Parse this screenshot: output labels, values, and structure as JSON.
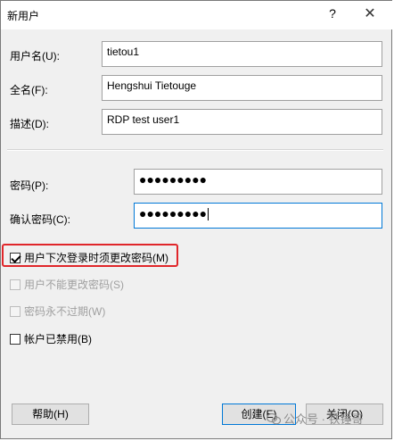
{
  "window": {
    "title": "新用户",
    "help_glyph": "?",
    "close_glyph": "✕"
  },
  "form": {
    "username_label": "用户名(U):",
    "username_value": "tietou1",
    "fullname_label": "全名(F):",
    "fullname_value": "Hengshui Tietouge",
    "description_label": "描述(D):",
    "description_value": "RDP test user1",
    "password_label": "密码(P):",
    "password_value": "●●●●●●●●●",
    "confirm_label": "确认密码(C):",
    "confirm_value": "●●●●●●●●●"
  },
  "options": {
    "must_change": {
      "label": "用户下次登录时须更改密码(M)",
      "checked": true
    },
    "cannot_change": {
      "label": "用户不能更改密码(S)",
      "checked": false
    },
    "never_expires": {
      "label": "密码永不过期(W)",
      "checked": false
    },
    "disabled": {
      "label": "帐户已禁用(B)",
      "checked": false
    }
  },
  "buttons": {
    "help": "帮助(H)",
    "create": "创建(E)",
    "close": "关闭(O)"
  },
  "watermark": {
    "text": "公众号 · 铁锤哥"
  }
}
